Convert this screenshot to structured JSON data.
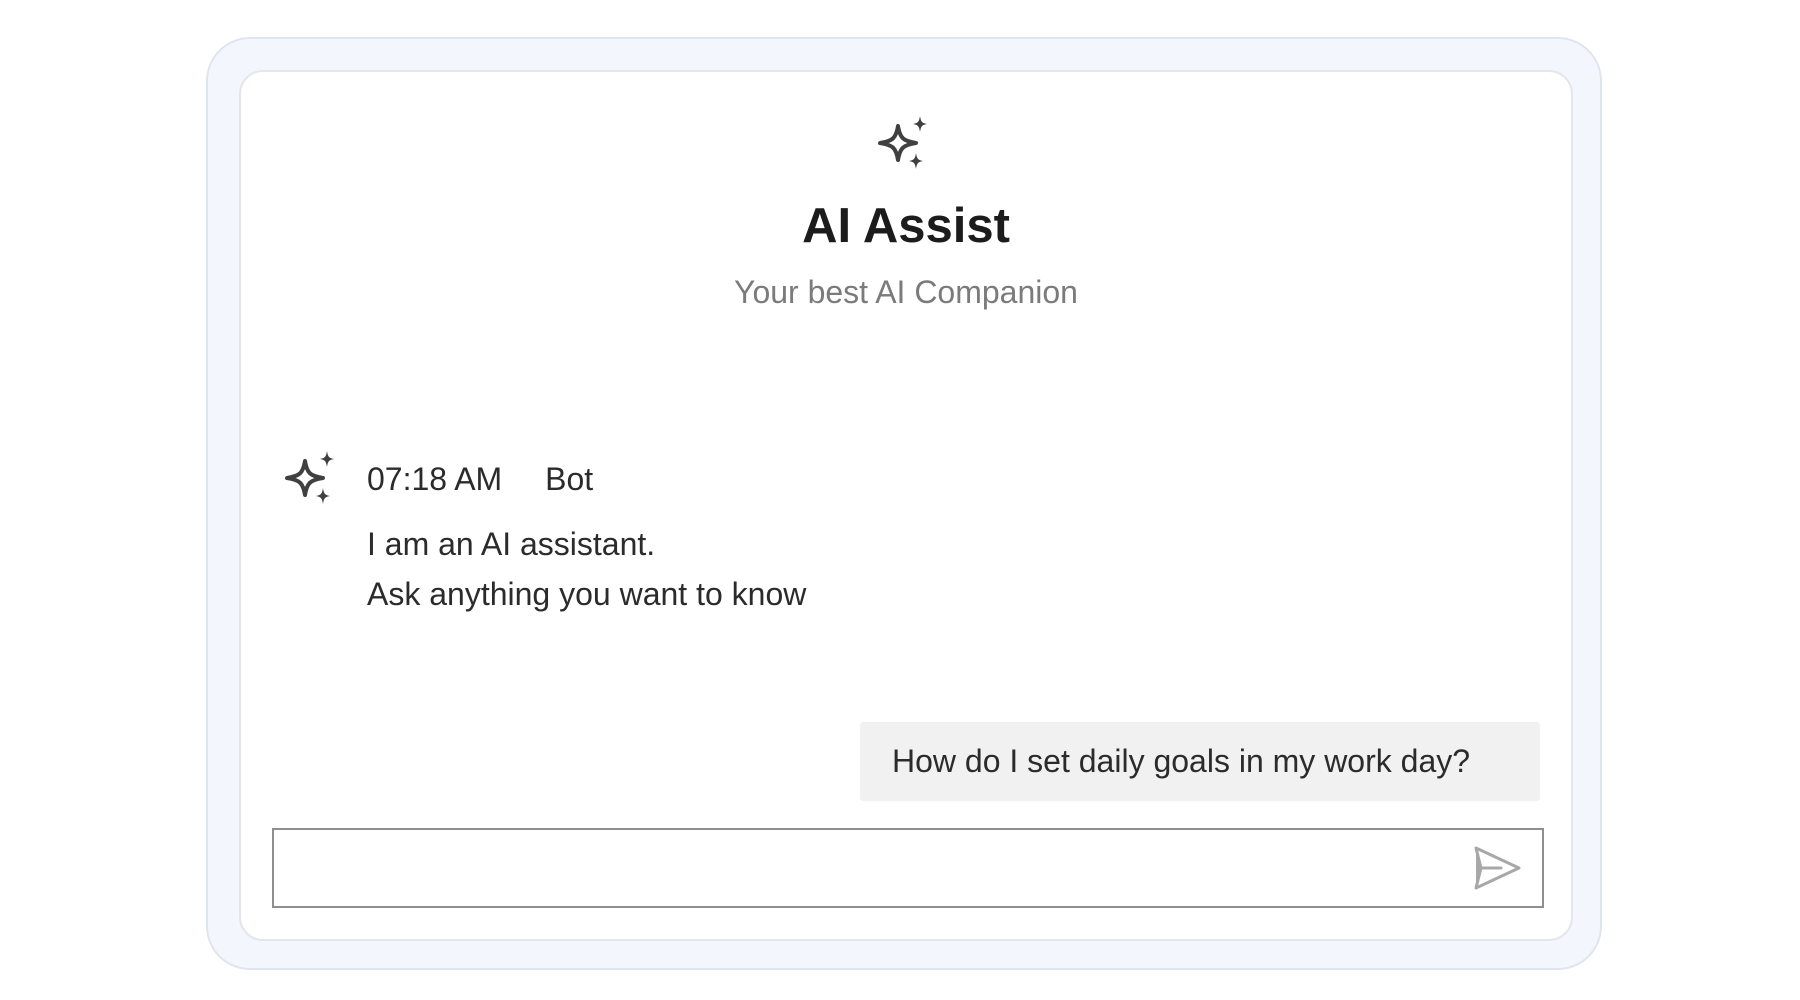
{
  "header": {
    "icon": "sparkles-icon",
    "title": "AI Assist",
    "subtitle": "Your best AI Companion"
  },
  "messages": {
    "bot": {
      "avatar_icon": "sparkles-icon",
      "time": "07:18 AM",
      "sender": "Bot",
      "lines": [
        "I am an AI assistant.",
        "Ask anything you want to know"
      ]
    },
    "user": {
      "text": "How do I set daily goals in my work day?"
    }
  },
  "composer": {
    "value": "",
    "placeholder": "",
    "send_icon": "send-icon"
  },
  "colors": {
    "frame_background": "#f3f7fd",
    "frame_border": "#dfe5ef",
    "card_background": "#ffffff",
    "icon": "#404040",
    "title": "#1c1c1c",
    "subtitle": "#7b7b7b",
    "user_bubble": "#f1f1f1",
    "input_border": "#8f8f8f",
    "send_icon": "#a8a8a8"
  }
}
